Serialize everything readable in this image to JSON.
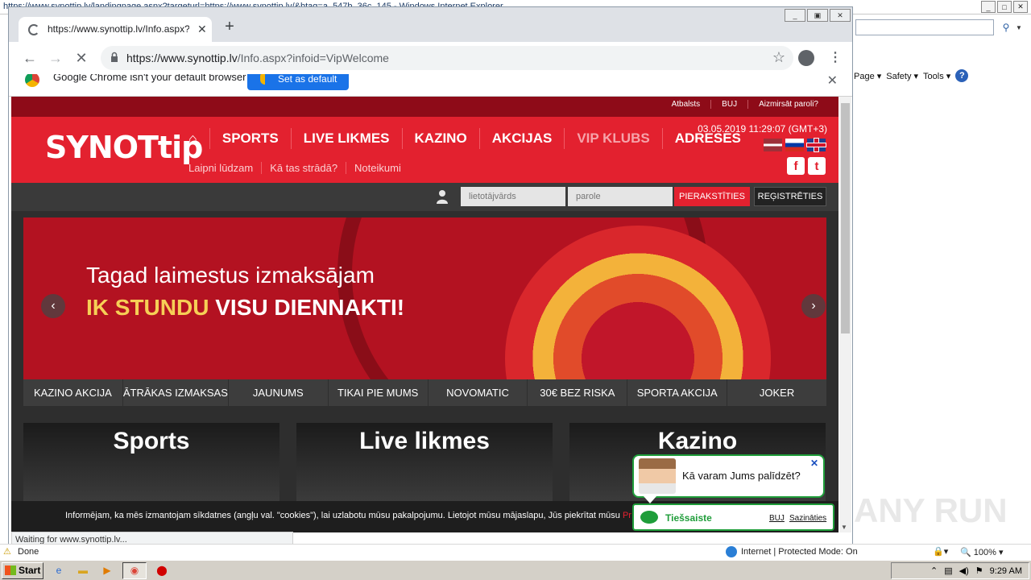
{
  "ie": {
    "window_title": "https://www.synottip.lv/landingpage.aspx?targeturl=https://www.synottip.lv/&btag=a_547b_36c_145 - Windows Internet Explorer",
    "command_bar": [
      "Page",
      "Safety",
      "Tools"
    ],
    "status_done": "Done",
    "zone_text": "Internet | Protected Mode: On",
    "zoom": "100%"
  },
  "taskbar": {
    "start_label": "Start",
    "clock": "9:29 AM"
  },
  "chrome": {
    "tab_title": "https://www.synottip.lv/Info.aspx?i",
    "url_host": "https://www.synottip.lv",
    "url_path": "/Info.aspx?infoid=VipWelcome",
    "infobar_message": "Google Chrome isn't your default browser",
    "infobar_button": "Set as default",
    "status_text": "Waiting for www.synottip.lv..."
  },
  "site": {
    "top_links": [
      "Atbalsts",
      "BUJ",
      "Aizmirsāt paroli?"
    ],
    "logo_text": "SYNOTtip",
    "nav": [
      "SPORTS",
      "LIVE LIKMES",
      "KAZINO",
      "AKCIJAS",
      "VIP KLUBS",
      "ADRESES"
    ],
    "subnav": [
      "Laipni lūdzam",
      "Kā tas strādā?",
      "Noteikumi"
    ],
    "datetime": "03.05.2019 11:29:07 (GMT+3)",
    "login": {
      "username_placeholder": "lietotājvārds",
      "password_placeholder": "parole",
      "login_button": "PIERAKSTĪTIES",
      "register_button": "REĢISTRĒTIES"
    },
    "banner": {
      "line1": "Tagad laimestus izmaksājam",
      "line2_gold": "IK STUNDU",
      "line2_white": "VISU DIENNAKTI!"
    },
    "categories": [
      "KAZINO AKCIJA",
      "ĀTRĀKAS IZMAKSAS",
      "JAUNUMS",
      "TIKAI PIE MUMS",
      "NOVOMATIC",
      "30€ BEZ RISKA",
      "SPORTA AKCIJA",
      "JOKER"
    ],
    "tiles": [
      "Sports",
      "Live likmes",
      "Kazino"
    ],
    "cookie_text": "Informējam, ka mēs izmantojam sīkdatnes (angļu val. \"cookies\"), lai uzlabotu mūsu pakalpojumu. Lietojot mūsu mājaslapu, Jūs piekrītat mūsu",
    "cookie_more": "Pr",
    "chat": {
      "question": "Kā varam Jums palīdzēt?",
      "status": "Tiešsaiste",
      "link1": "BUJ",
      "link2": "Sazināties"
    }
  },
  "watermark": "ANY RUN"
}
